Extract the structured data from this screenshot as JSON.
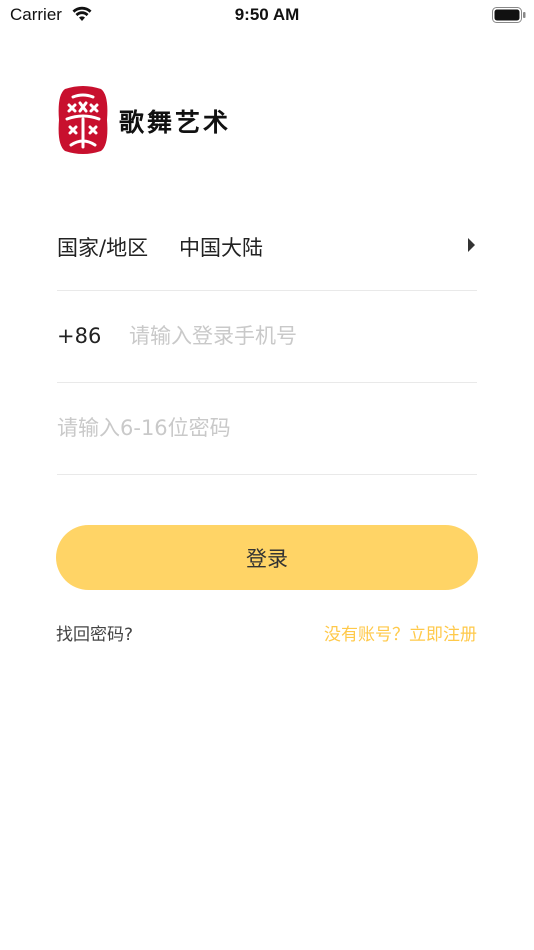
{
  "status_bar": {
    "carrier": "Carrier",
    "time": "9:50 AM"
  },
  "logo": {
    "text": "歌舞艺术",
    "seal_color": "#c8102e"
  },
  "form": {
    "region": {
      "label": "国家/地区",
      "value": "中国大陆"
    },
    "phone": {
      "prefix": "+86",
      "placeholder": "请输入登录手机号"
    },
    "password": {
      "placeholder": "请输入6-16位密码"
    }
  },
  "login_button": {
    "label": "登录",
    "color": "#ffd466"
  },
  "links": {
    "forgot_password": "找回密码?",
    "register": "没有账号？立即注册",
    "register_color": "#ffc94a"
  }
}
